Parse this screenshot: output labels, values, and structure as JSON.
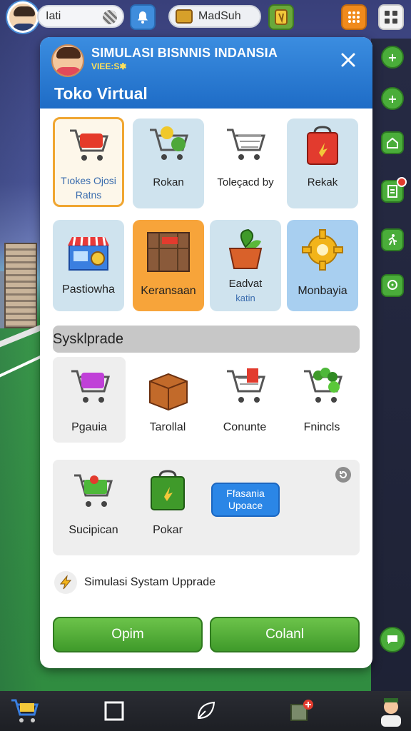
{
  "top_bar": {
    "name": "Iati",
    "money_label": "MadSuh"
  },
  "modal": {
    "title": "SIMULASI BISNNIS INDANSIA",
    "subtitle": "VIEE:S✱",
    "section_title": "Toko Virtual",
    "close_icon": "close-icon",
    "shop_tiles": [
      {
        "label": "Tıokes Ojosi",
        "label2": "Ratns",
        "icon": "cart-red-icon",
        "selected": true
      },
      {
        "label": "Rokan",
        "icon": "cart-produce-icon"
      },
      {
        "label": "Toleçacd by",
        "icon": "cart-empty-icon"
      },
      {
        "label": "Rekak",
        "icon": "red-bag-icon"
      },
      {
        "label": "Pastiowha",
        "icon": "storefront-icon"
      },
      {
        "label": "Keransaan",
        "icon": "crate-icon"
      },
      {
        "label": "Eadvat",
        "label2": "katin",
        "icon": "potted-plant-icon"
      },
      {
        "label": "Monbayia",
        "icon": "gear-icon"
      }
    ],
    "section2_title": "Sysklprade",
    "items_row": [
      {
        "label": "Pgauia",
        "icon": "cart-purple-icon"
      },
      {
        "label": "Tarollal",
        "icon": "box-icon"
      },
      {
        "label": "Conunte",
        "icon": "cart-red-bag-icon"
      },
      {
        "label": "Fnincls",
        "icon": "cart-vegetables-icon"
      }
    ],
    "upgrade_box": {
      "items": [
        {
          "label": "Sucipican",
          "icon": "cart-green-icon"
        },
        {
          "label": "Pokar",
          "icon": "green-bag-icon"
        }
      ],
      "button_line1": "Ffasania",
      "button_line2": "Upoace"
    },
    "system_upgrade_label": "Simulasi Systam Upprade",
    "btn_left": "Opim",
    "btn_right": "Colanl"
  },
  "colors": {
    "header_blue": "#2b7fd6",
    "accent_orange": "#f0a631",
    "button_green": "#4caf35",
    "update_blue": "#2b86e6"
  }
}
